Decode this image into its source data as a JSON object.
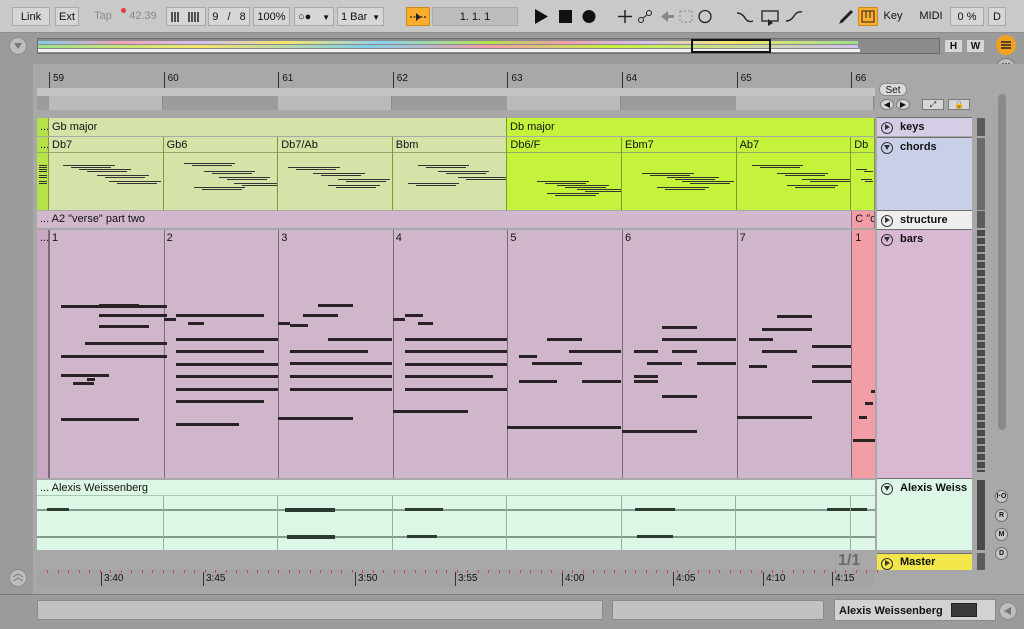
{
  "transport": {
    "link_label": "Link",
    "ext_label": "Ext",
    "tap_label": "Tap",
    "tempo": "42.39",
    "time_sig_num": "9",
    "time_sig_sep": "/",
    "time_sig_den": "8",
    "zoom": "100%",
    "metronome_label": "○●",
    "quantize": "1 Bar",
    "position": "1.   1.   1",
    "key_label": "Key",
    "midi_label": "MIDI",
    "cpu": "0 %",
    "d_label": "D"
  },
  "overview": {
    "h_label": "H",
    "w_label": "W"
  },
  "ruler": {
    "bars": [
      "59",
      "60",
      "61",
      "62",
      "63",
      "64",
      "65",
      "66"
    ]
  },
  "set_label": "Set",
  "tracks": [
    {
      "name": "keys"
    },
    {
      "name": "chords"
    },
    {
      "name": "structure"
    },
    {
      "name": "bars"
    },
    {
      "name": "Alexis Weiss"
    },
    {
      "name": "Master"
    }
  ],
  "keys_clips": [
    {
      "label": "...",
      "color": "#b7e14a"
    },
    {
      "label": "Gb major",
      "color": "#d6e3a8"
    },
    {
      "label": "Db major",
      "color": "#c5f33c"
    }
  ],
  "chord_clips": [
    {
      "label": "...",
      "color": "#b7e14a"
    },
    {
      "label": "Db7",
      "color": "#d6e3a8"
    },
    {
      "label": "Gb6",
      "color": "#d6e3a8"
    },
    {
      "label": "Db7/Ab",
      "color": "#d6e3a8"
    },
    {
      "label": "Bbm",
      "color": "#d6e3a8"
    },
    {
      "label": "Db6/F",
      "color": "#c5f33c"
    },
    {
      "label": "Ebm7",
      "color": "#c5f33c"
    },
    {
      "label": "Ab7",
      "color": "#c5f33c"
    },
    {
      "label": "Db",
      "color": "#c5f33c"
    }
  ],
  "structure_clips": [
    {
      "label": "... A2 \"verse\" part two",
      "color": "#d2b8cd"
    },
    {
      "label": "C \"c",
      "color": "#f39ea7"
    }
  ],
  "bars_clips": {
    "prefix": "...",
    "numbers": [
      "1",
      "2",
      "3",
      "4",
      "5",
      "6",
      "7"
    ],
    "last": "1",
    "color": "#cfb6ca",
    "last_color": "#f39ea7"
  },
  "audio_clip": {
    "label": "... Alexis Weissenberg",
    "color": "#ddf7e6"
  },
  "pager": "1/1",
  "time_ruler": [
    "3:40",
    "3:45",
    "3:50",
    "3:55",
    "4:00",
    "4:05",
    "4:10",
    "4:15"
  ],
  "status": {
    "selected_track": "Alexis Weissenberg"
  },
  "side_buttons": [
    "I·O",
    "R",
    "M",
    "D"
  ],
  "colors": {
    "accent_orange": "#ffad2e",
    "keys_track": "#d6cce6",
    "chords_track": "#c9cfe8",
    "structure_track": "#eeeeee",
    "bars_track": "#d9b8d4",
    "audio_track": "#ddf7e6",
    "master_track": "#f2e64a"
  }
}
